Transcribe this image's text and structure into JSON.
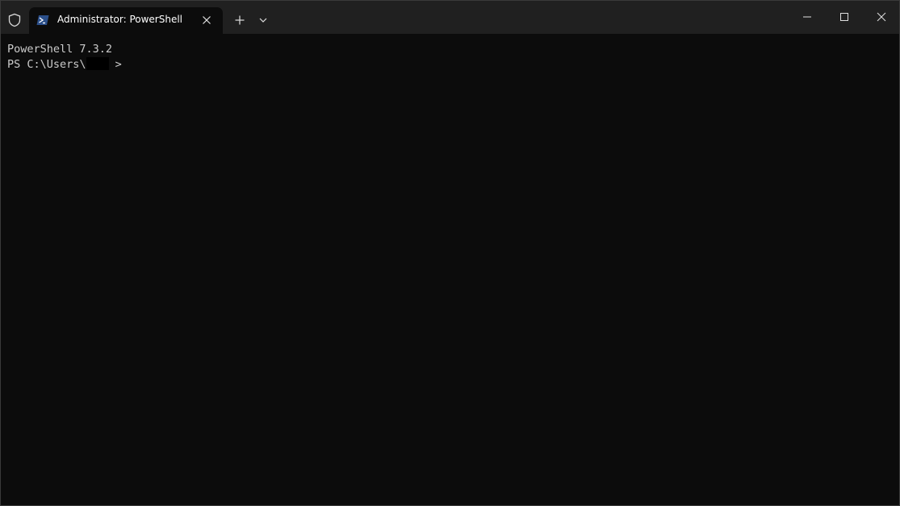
{
  "titlebar": {
    "tab_title": "Administrator: PowerShell",
    "new_tab_glyph": "+",
    "icons": {
      "shield": "shield-icon",
      "powershell": "powershell-icon",
      "close_tab": "close-icon",
      "new_tab": "plus-icon",
      "dropdown": "chevron-down-icon",
      "minimize": "minimize-icon",
      "maximize": "maximize-icon",
      "close_window": "close-icon"
    }
  },
  "terminal": {
    "version_line": "PowerShell 7.3.2",
    "prompt_prefix": "PS C:\\Users\\",
    "prompt_suffix": " >"
  },
  "colors": {
    "background": "#0c0c0c",
    "titlebar": "#202020",
    "text": "#cccccc",
    "ps_icon": "#2b4f8a"
  }
}
